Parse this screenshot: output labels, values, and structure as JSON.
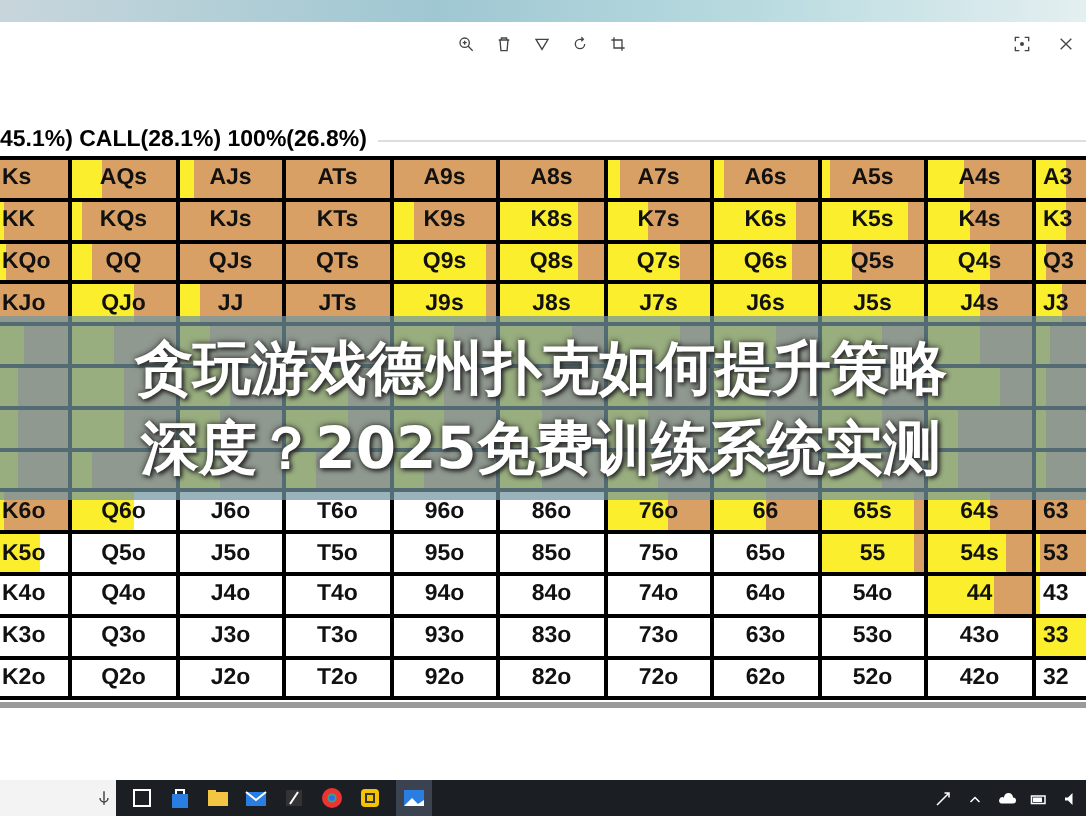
{
  "summary": "45.1%) CALL(28.1%) 100%(26.8%)",
  "grid": {
    "rows": [
      [
        {
          "label": "Ks",
          "kind": "raise",
          "level": 0
        },
        {
          "label": "AQs",
          "kind": "raise",
          "level": 0.3
        },
        {
          "label": "AJs",
          "kind": "raise",
          "level": 0.15
        },
        {
          "label": "ATs",
          "kind": "raise",
          "level": 0
        },
        {
          "label": "A9s",
          "kind": "raise",
          "level": 0
        },
        {
          "label": "A8s",
          "kind": "raise",
          "level": 0
        },
        {
          "label": "A7s",
          "kind": "raise",
          "level": 0.12
        },
        {
          "label": "A6s",
          "kind": "raise",
          "level": 0.1
        },
        {
          "label": "A5s",
          "kind": "raise",
          "level": 0.08
        },
        {
          "label": "A4s",
          "kind": "raise",
          "level": 0.35
        },
        {
          "label": "A3",
          "kind": "raise",
          "level": 0.6
        }
      ],
      [
        {
          "label": "KK",
          "kind": "raise",
          "level": 0.1
        },
        {
          "label": "KQs",
          "kind": "raise",
          "level": 0.1
        },
        {
          "label": "KJs",
          "kind": "raise",
          "level": 0
        },
        {
          "label": "KTs",
          "kind": "raise",
          "level": 0
        },
        {
          "label": "K9s",
          "kind": "raise",
          "level": 0.2
        },
        {
          "label": "K8s",
          "kind": "raise",
          "level": 0.75
        },
        {
          "label": "K7s",
          "kind": "raise",
          "level": 0.4
        },
        {
          "label": "K6s",
          "kind": "raise",
          "level": 0.8
        },
        {
          "label": "K5s",
          "kind": "raise",
          "level": 0.85
        },
        {
          "label": "K4s",
          "kind": "raise",
          "level": 0.4
        },
        {
          "label": "K3",
          "kind": "raise",
          "level": 0.6
        }
      ],
      [
        {
          "label": "KQo",
          "kind": "raise",
          "level": 0.15
        },
        {
          "label": "QQ",
          "kind": "raise",
          "level": 0.2
        },
        {
          "label": "QJs",
          "kind": "raise",
          "level": 0
        },
        {
          "label": "QTs",
          "kind": "raise",
          "level": 0
        },
        {
          "label": "Q9s",
          "kind": "raise",
          "level": 0.9
        },
        {
          "label": "Q8s",
          "kind": "raise",
          "level": 0.75
        },
        {
          "label": "Q7s",
          "kind": "raise",
          "level": 0.7
        },
        {
          "label": "Q6s",
          "kind": "raise",
          "level": 0.75
        },
        {
          "label": "Q5s",
          "kind": "raise",
          "level": 0.3
        },
        {
          "label": "Q4s",
          "kind": "raise",
          "level": 0.6
        },
        {
          "label": "Q3",
          "kind": "raise",
          "level": 0.2
        }
      ],
      [
        {
          "label": "KJo",
          "kind": "raise",
          "level": 0
        },
        {
          "label": "QJo",
          "kind": "raise",
          "level": 0.6
        },
        {
          "label": "JJ",
          "kind": "raise",
          "level": 0.2
        },
        {
          "label": "JTs",
          "kind": "raise",
          "level": 0
        },
        {
          "label": "J9s",
          "kind": "raise",
          "level": 0.9
        },
        {
          "label": "J8s",
          "kind": "raise",
          "level": 1
        },
        {
          "label": "J7s",
          "kind": "raise",
          "level": 1
        },
        {
          "label": "J6s",
          "kind": "raise",
          "level": 1
        },
        {
          "label": "J5s",
          "kind": "raise",
          "level": 1
        },
        {
          "label": "J4s",
          "kind": "raise",
          "level": 0.5
        },
        {
          "label": "J3",
          "kind": "raise",
          "level": 0.5
        }
      ],
      [
        {
          "kind": "raise",
          "level": 0.4
        },
        {
          "kind": "raise",
          "level": 0.4
        },
        {
          "kind": "raise",
          "level": 0.3
        },
        {
          "kind": "raise",
          "level": 0
        },
        {
          "kind": "raise",
          "level": 0.6
        },
        {
          "kind": "raise",
          "level": 0.7
        },
        {
          "kind": "raise",
          "level": 0.7
        },
        {
          "kind": "raise",
          "level": 0.6
        },
        {
          "kind": "raise",
          "level": 0.6
        },
        {
          "kind": "raise",
          "level": 0.5
        },
        {
          "kind": "raise",
          "level": 0.3
        }
      ],
      [
        {
          "kind": "raise",
          "level": 0.3
        },
        {
          "kind": "raise",
          "level": 0.5
        },
        {
          "kind": "raise",
          "level": 0.5
        },
        {
          "kind": "raise",
          "level": 0.6
        },
        {
          "kind": "raise",
          "level": 0.5
        },
        {
          "kind": "raise",
          "level": 0.4
        },
        {
          "kind": "raise",
          "level": 0.4
        },
        {
          "kind": "raise",
          "level": 0.5
        },
        {
          "kind": "raise",
          "level": 0.6
        },
        {
          "kind": "raise",
          "level": 0.7
        },
        {
          "kind": "raise",
          "level": 0.2
        }
      ],
      [
        {
          "kind": "raise",
          "level": 0.3
        },
        {
          "kind": "raise",
          "level": 0.5
        },
        {
          "kind": "raise",
          "level": 0.4
        },
        {
          "kind": "raise",
          "level": 0.6
        },
        {
          "kind": "raise",
          "level": 0.5
        },
        {
          "kind": "raise",
          "level": 0.4
        },
        {
          "kind": "raise",
          "level": 0.4
        },
        {
          "kind": "raise",
          "level": 0.5
        },
        {
          "kind": "raise",
          "level": 0.6
        },
        {
          "kind": "raise",
          "level": 0.3
        },
        {
          "kind": "raise",
          "level": 0.2
        }
      ],
      [
        {
          "kind": "raise",
          "level": 0.3
        },
        {
          "kind": "raise",
          "level": 0.2
        },
        {
          "kind": "raise",
          "level": 0.4
        },
        {
          "kind": "raise",
          "level": 0.3
        },
        {
          "kind": "raise",
          "level": 0.3
        },
        {
          "kind": "raise",
          "level": 0.4
        },
        {
          "kind": "raise",
          "level": 0.5
        },
        {
          "kind": "raise",
          "level": 0.5
        },
        {
          "kind": "raise",
          "level": 0.6
        },
        {
          "kind": "raise",
          "level": 0.3
        },
        {
          "kind": "raise",
          "level": 0.2
        }
      ],
      [
        {
          "label": "K6o",
          "kind": "raise",
          "level": 0.1
        },
        {
          "label": "Q6o",
          "kind": "fold",
          "level": 0.6
        },
        {
          "label": "J6o",
          "kind": "fold",
          "level": 0
        },
        {
          "label": "T6o",
          "kind": "fold",
          "level": 0
        },
        {
          "label": "96o",
          "kind": "fold",
          "level": 0
        },
        {
          "label": "86o",
          "kind": "fold",
          "level": 0
        },
        {
          "label": "76o",
          "kind": "raise",
          "level": 0.6
        },
        {
          "label": "66",
          "kind": "raise",
          "level": 0.5
        },
        {
          "label": "65s",
          "kind": "raise",
          "level": 0.9
        },
        {
          "label": "64s",
          "kind": "raise",
          "level": 0.6
        },
        {
          "label": "63",
          "kind": "raise",
          "level": 0
        }
      ],
      [
        {
          "label": "K5o",
          "kind": "fold",
          "level": 0.6
        },
        {
          "label": "Q5o",
          "kind": "fold",
          "level": 0
        },
        {
          "label": "J5o",
          "kind": "fold",
          "level": 0
        },
        {
          "label": "T5o",
          "kind": "fold",
          "level": 0
        },
        {
          "label": "95o",
          "kind": "fold",
          "level": 0
        },
        {
          "label": "85o",
          "kind": "fold",
          "level": 0
        },
        {
          "label": "75o",
          "kind": "fold",
          "level": 0
        },
        {
          "label": "65o",
          "kind": "fold",
          "level": 0
        },
        {
          "label": "55",
          "kind": "raise",
          "level": 0.9
        },
        {
          "label": "54s",
          "kind": "raise",
          "level": 0.75
        },
        {
          "label": "53",
          "kind": "raise",
          "level": 0.1
        }
      ],
      [
        {
          "label": "K4o",
          "kind": "fold",
          "level": 0
        },
        {
          "label": "Q4o",
          "kind": "fold",
          "level": 0
        },
        {
          "label": "J4o",
          "kind": "fold",
          "level": 0
        },
        {
          "label": "T4o",
          "kind": "fold",
          "level": 0
        },
        {
          "label": "94o",
          "kind": "fold",
          "level": 0
        },
        {
          "label": "84o",
          "kind": "fold",
          "level": 0
        },
        {
          "label": "74o",
          "kind": "fold",
          "level": 0
        },
        {
          "label": "64o",
          "kind": "fold",
          "level": 0
        },
        {
          "label": "54o",
          "kind": "fold",
          "level": 0
        },
        {
          "label": "44",
          "kind": "raise",
          "level": 0.65
        },
        {
          "label": "43",
          "kind": "fold",
          "level": 0.1
        }
      ],
      [
        {
          "label": "K3o",
          "kind": "fold",
          "level": 0
        },
        {
          "label": "Q3o",
          "kind": "fold",
          "level": 0
        },
        {
          "label": "J3o",
          "kind": "fold",
          "level": 0
        },
        {
          "label": "T3o",
          "kind": "fold",
          "level": 0
        },
        {
          "label": "93o",
          "kind": "fold",
          "level": 0
        },
        {
          "label": "83o",
          "kind": "fold",
          "level": 0
        },
        {
          "label": "73o",
          "kind": "fold",
          "level": 0
        },
        {
          "label": "63o",
          "kind": "fold",
          "level": 0
        },
        {
          "label": "53o",
          "kind": "fold",
          "level": 0
        },
        {
          "label": "43o",
          "kind": "fold",
          "level": 0
        },
        {
          "label": "33",
          "kind": "fold",
          "level": 1
        }
      ],
      [
        {
          "label": "K2o",
          "kind": "fold",
          "level": 0
        },
        {
          "label": "Q2o",
          "kind": "fold",
          "level": 0
        },
        {
          "label": "J2o",
          "kind": "fold",
          "level": 0
        },
        {
          "label": "T2o",
          "kind": "fold",
          "level": 0
        },
        {
          "label": "92o",
          "kind": "fold",
          "level": 0
        },
        {
          "label": "82o",
          "kind": "fold",
          "level": 0
        },
        {
          "label": "72o",
          "kind": "fold",
          "level": 0
        },
        {
          "label": "62o",
          "kind": "fold",
          "level": 0
        },
        {
          "label": "52o",
          "kind": "fold",
          "level": 0
        },
        {
          "label": "42o",
          "kind": "fold",
          "level": 0
        },
        {
          "label": "32",
          "kind": "fold",
          "level": 0
        }
      ]
    ]
  },
  "banner": {
    "lines": [
      "贪玩游戏德州扑克如何提升策略",
      "深度？2025免费训练系统实测"
    ]
  }
}
